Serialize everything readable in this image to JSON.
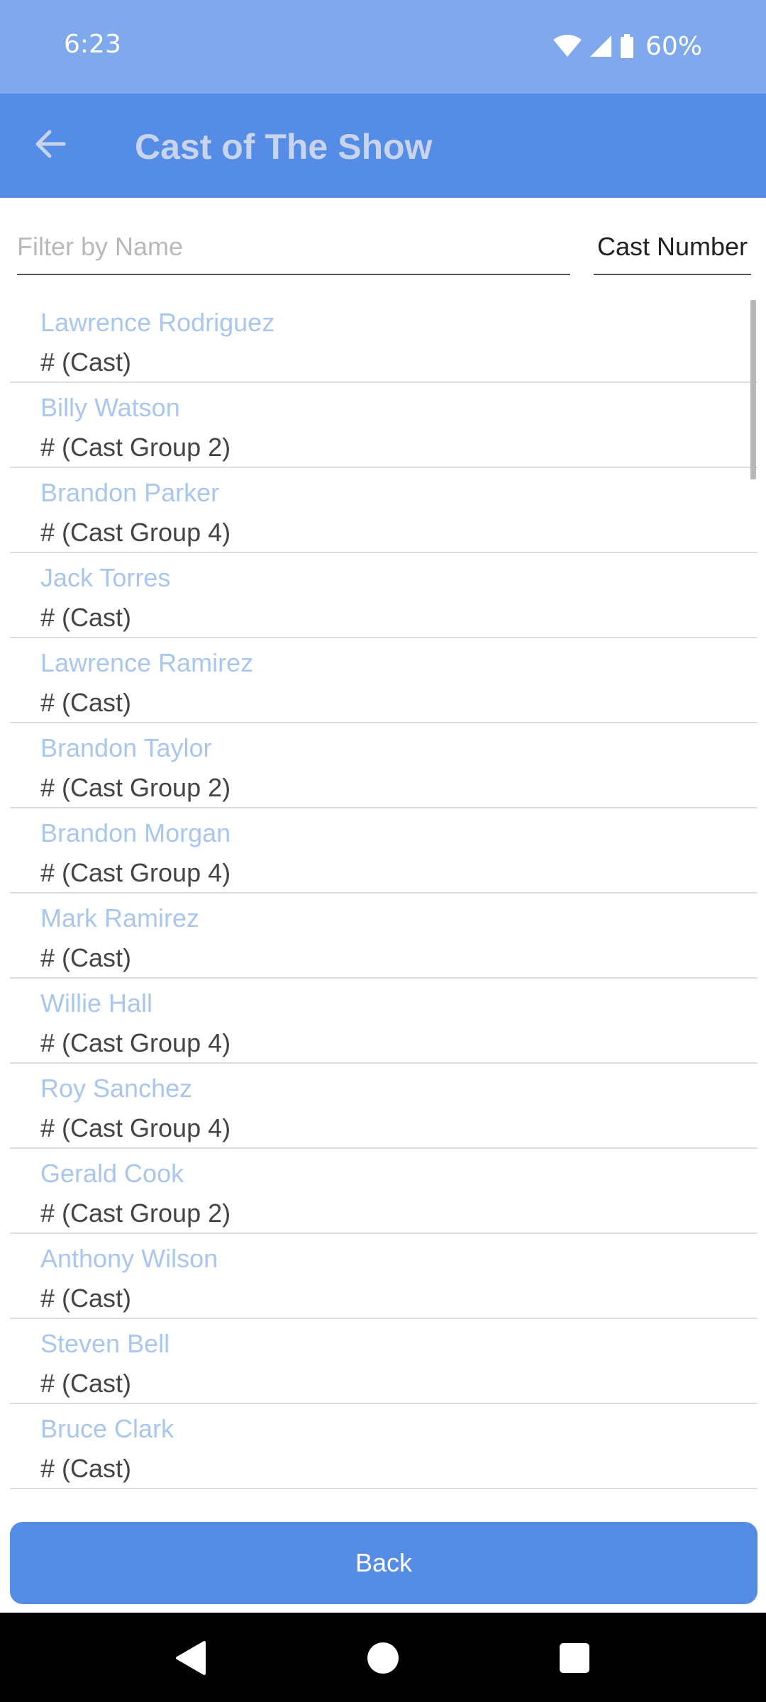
{
  "status_bar": {
    "time": "6:23",
    "battery": "60%"
  },
  "app_bar": {
    "title": "Cast of The Show"
  },
  "filter": {
    "placeholder": "Filter by Name",
    "cast_number_label": "Cast Number"
  },
  "cast_list": [
    {
      "name": "Lawrence Rodriguez",
      "group": "# (Cast)"
    },
    {
      "name": "Billy Watson",
      "group": "# (Cast Group 2)"
    },
    {
      "name": "Brandon Parker",
      "group": "# (Cast Group 4)"
    },
    {
      "name": "Jack Torres",
      "group": "# (Cast)"
    },
    {
      "name": "Lawrence Ramirez",
      "group": "# (Cast)"
    },
    {
      "name": "Brandon Taylor",
      "group": "# (Cast Group 2)"
    },
    {
      "name": "Brandon Morgan",
      "group": "# (Cast Group 4)"
    },
    {
      "name": "Mark Ramirez",
      "group": "# (Cast)"
    },
    {
      "name": "Willie Hall",
      "group": "# (Cast Group 4)"
    },
    {
      "name": "Roy Sanchez",
      "group": "# (Cast Group 4)"
    },
    {
      "name": "Gerald Cook",
      "group": "# (Cast Group 2)"
    },
    {
      "name": "Anthony Wilson",
      "group": "# (Cast)"
    },
    {
      "name": "Steven Bell",
      "group": "# (Cast)"
    },
    {
      "name": "Bruce Clark",
      "group": "# (Cast)"
    }
  ],
  "footer": {
    "back_label": "Back"
  },
  "colors": {
    "status_bar": "#7fa9ec",
    "app_bar": "#548ce6",
    "title_text": "#c7d4ec",
    "name_text": "#a9c6ef",
    "group_text": "#444444",
    "button": "#548ce6",
    "nav_bar": "#000000"
  },
  "icons": {
    "back": "arrow-left-icon",
    "wifi": "wifi-icon",
    "signal": "cell-signal-icon",
    "battery": "battery-icon",
    "nav_back": "nav-back-triangle-icon",
    "nav_home": "nav-home-circle-icon",
    "nav_recents": "nav-recents-square-icon"
  }
}
